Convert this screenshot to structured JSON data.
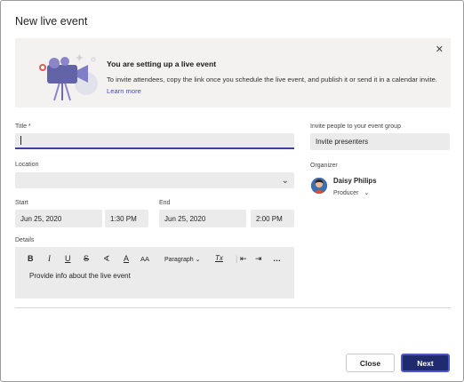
{
  "dialog": {
    "title": "New live event"
  },
  "banner": {
    "heading": "You are setting up a live event",
    "text": "To invite attendees, copy the link once you schedule the live event, and publish it or send it in a calendar invite.",
    "link": "Learn more",
    "close_icon": "close-icon"
  },
  "form": {
    "title_label": "Title *",
    "title_value": "",
    "location_label": "Location",
    "location_value": "",
    "start_label": "Start",
    "start_date": "Jun 25, 2020",
    "start_time": "1:30 PM",
    "end_label": "End",
    "end_date": "Jun 25, 2020",
    "end_time": "2:00 PM",
    "details_label": "Details",
    "details_placeholder": "Provide info about the live event",
    "toolbar": {
      "bold": "B",
      "italic": "I",
      "underline": "U",
      "strike": "S",
      "highlight": "∢",
      "font_color": "A",
      "font_size": "AA",
      "paragraph": "Paragraph",
      "clear": "Tx",
      "more": "…"
    }
  },
  "sidebar": {
    "invite_label": "Invite people to your event group",
    "invite_value": "Invite presenters",
    "organizer_label": "Organizer",
    "organizer_name": "Daisy Philips",
    "organizer_role": "Producer"
  },
  "footer": {
    "close": "Close",
    "next": "Next"
  },
  "colors": {
    "accent": "#464eb8",
    "next_bg": "#202a6e"
  }
}
